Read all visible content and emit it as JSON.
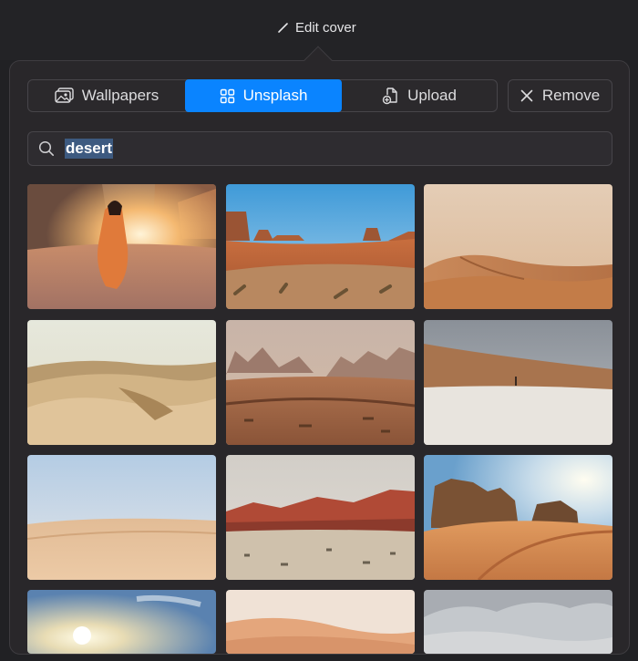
{
  "header": {
    "title": "Edit cover",
    "icon": "pencil-icon"
  },
  "tabs": [
    {
      "label": "Wallpapers",
      "icon": "photo-icon",
      "selected": false
    },
    {
      "label": "Unsplash",
      "icon": "grid-icon",
      "selected": true
    },
    {
      "label": "Upload",
      "icon": "upload-file-icon",
      "selected": false
    }
  ],
  "remove": {
    "label": "Remove",
    "icon": "close-icon"
  },
  "search": {
    "value": "desert",
    "icon": "search-icon"
  },
  "colors": {
    "accent": "#0a84ff",
    "panel": "#29272a",
    "background": "#212124"
  },
  "results": [
    {
      "id": "woman-canyon"
    },
    {
      "id": "monument-valley"
    },
    {
      "id": "orange-dunes"
    },
    {
      "id": "pale-dunes"
    },
    {
      "id": "hazy-mountains"
    },
    {
      "id": "white-flat-ridge"
    },
    {
      "id": "smooth-dunes"
    },
    {
      "id": "red-rocks"
    },
    {
      "id": "rock-formation-sunset"
    },
    {
      "id": "sun-sky"
    },
    {
      "id": "peach-dune"
    },
    {
      "id": "grey-clouds"
    }
  ]
}
